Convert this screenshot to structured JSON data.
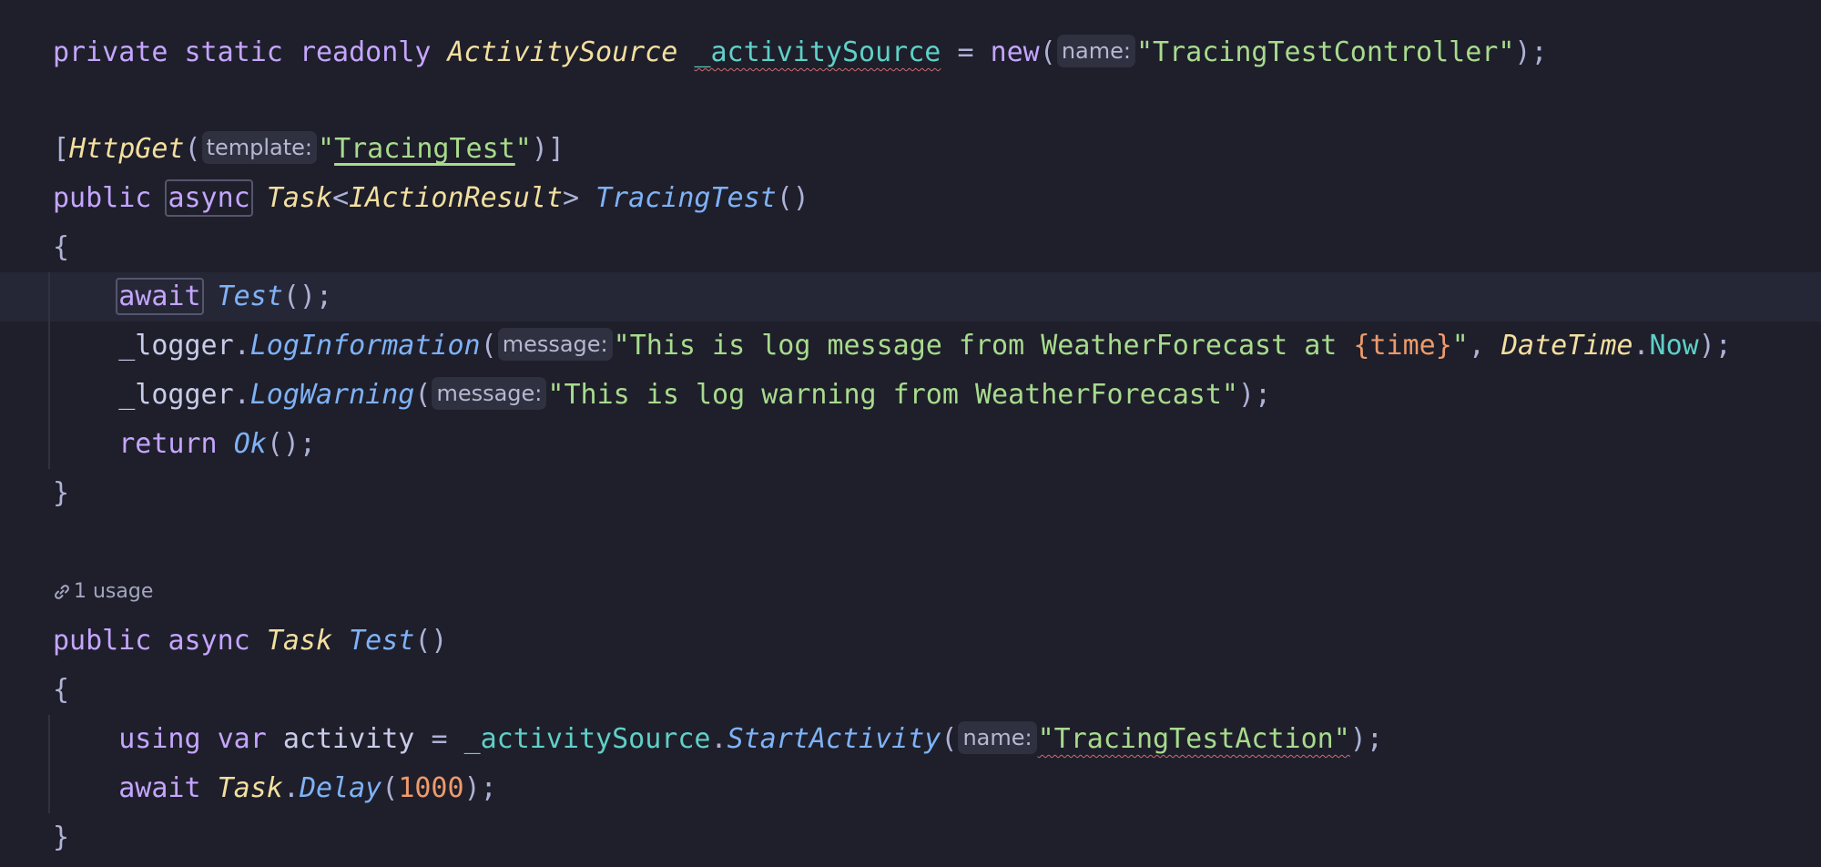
{
  "colors": {
    "background": "#1e1f2b",
    "keyword": "#c5a5ff",
    "type": "#f3df9f",
    "method": "#7fb2f6",
    "field": "#5fd0c7",
    "string": "#a8db8c",
    "number": "#ee9a6a"
  },
  "icons": {
    "usage": "link-icon"
  },
  "code": {
    "line1": {
      "kw1": "private",
      "kw2": "static",
      "kw3": "readonly",
      "type": "ActivitySource",
      "field": "_activitySource",
      "op": "=",
      "kw_new": "new",
      "open": "(",
      "hint": "name:",
      "str": "\"TracingTestController\"",
      "close": ");"
    },
    "line3": {
      "open_bracket": "[",
      "attr": "HttpGet",
      "open": "(",
      "hint": "template:",
      "str_q1": "\"",
      "str_body": "TracingTest",
      "str_q2": "\"",
      "close": ")]"
    },
    "line4": {
      "kw1": "public",
      "kw_async": "async",
      "type_task": "Task",
      "lt": "<",
      "type_result": "IActionResult",
      "gt": ">",
      "method": "TracingTest",
      "parens": "()"
    },
    "line5": {
      "brace": "{"
    },
    "line6": {
      "kw_await": "await",
      "method": "Test",
      "tail": "();"
    },
    "line7": {
      "obj": "_logger",
      "dot": ".",
      "method": "LogInformation",
      "open": "(",
      "hint": "message:",
      "str_a": "\"This is log message from WeatherForecast at ",
      "str_interp": "{time}",
      "str_b": "\"",
      "comma": ", ",
      "type_dt": "DateTime",
      "dot2": ".",
      "prop": "Now",
      "close": ");"
    },
    "line8": {
      "obj": "_logger",
      "dot": ".",
      "method": "LogWarning",
      "open": "(",
      "hint": "message:",
      "str": "\"This is log warning from WeatherForecast\"",
      "close": ");"
    },
    "line9": {
      "kw_return": "return",
      "method": "Ok",
      "tail": "();"
    },
    "line10": {
      "brace": "}"
    },
    "usage_label": "1 usage",
    "line12": {
      "kw1": "public",
      "kw_async": "async",
      "type_task": "Task",
      "method": "Test",
      "parens": "()"
    },
    "line13": {
      "brace": "{"
    },
    "line14": {
      "kw_using": "using",
      "kw_var": "var",
      "var": "activity",
      "op": "=",
      "field": "_activitySource",
      "dot": ".",
      "method": "StartActivity",
      "open": "(",
      "hint": "name:",
      "str": "\"TracingTestAction\"",
      "close": ");"
    },
    "line15": {
      "kw_await": "await",
      "type_task": "Task",
      "dot": ".",
      "method": "Delay",
      "open": "(",
      "num": "1000",
      "close": ");"
    },
    "line16": {
      "brace": "}"
    }
  }
}
